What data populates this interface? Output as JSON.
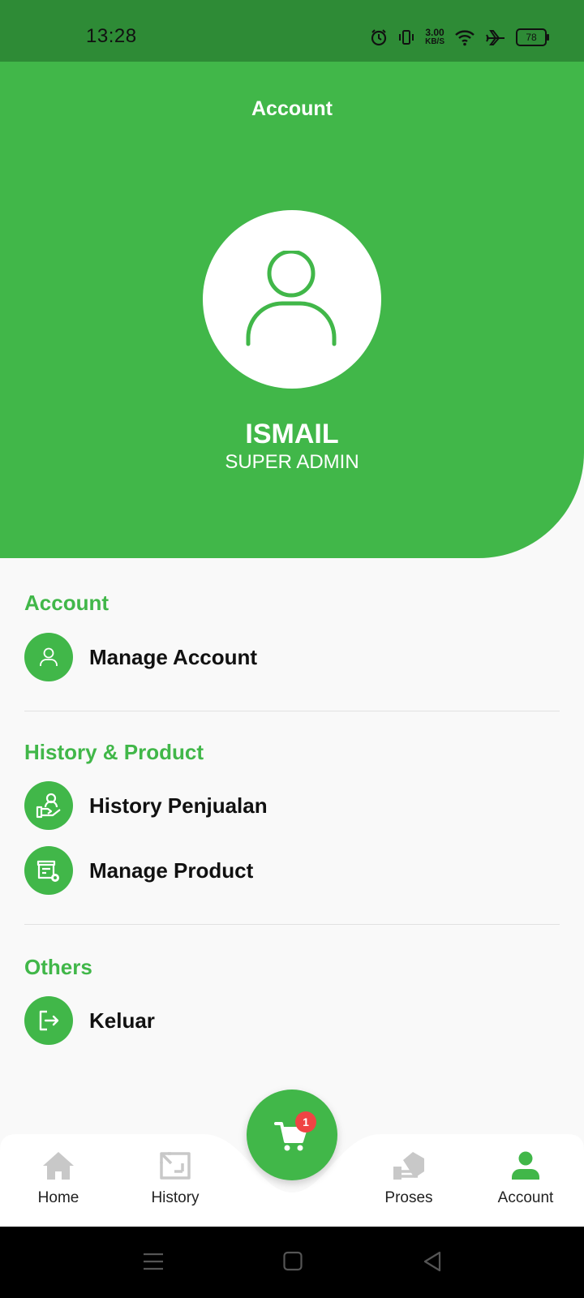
{
  "status_bar": {
    "time": "13:28",
    "net_speed_value": "3.00",
    "net_speed_unit": "KB/S",
    "battery": "78"
  },
  "header": {
    "title": "Account"
  },
  "profile": {
    "name": "ISMAIL",
    "role": "SUPER ADMIN"
  },
  "sections": [
    {
      "title": "Account",
      "items": [
        {
          "label": "Manage Account",
          "icon": "user-icon"
        }
      ]
    },
    {
      "title": "History & Product",
      "items": [
        {
          "label": "History Penjualan",
          "icon": "hand-user-icon"
        },
        {
          "label": "Manage Product",
          "icon": "product-settings-icon"
        }
      ]
    },
    {
      "title": "Others",
      "items": [
        {
          "label": "Keluar",
          "icon": "logout-icon"
        }
      ]
    }
  ],
  "bottom_nav": {
    "items": [
      {
        "label": "Home",
        "icon": "home-icon"
      },
      {
        "label": "History",
        "icon": "history-icon"
      },
      {
        "label": "Proses",
        "icon": "proses-icon"
      },
      {
        "label": "Account",
        "icon": "account-icon"
      }
    ],
    "active": "Account",
    "cart_badge": "1"
  },
  "colors": {
    "primary": "#41b749",
    "status_bar": "#2e8b36",
    "badge": "#ef4444",
    "inactive_icon": "#c8c8c8"
  }
}
